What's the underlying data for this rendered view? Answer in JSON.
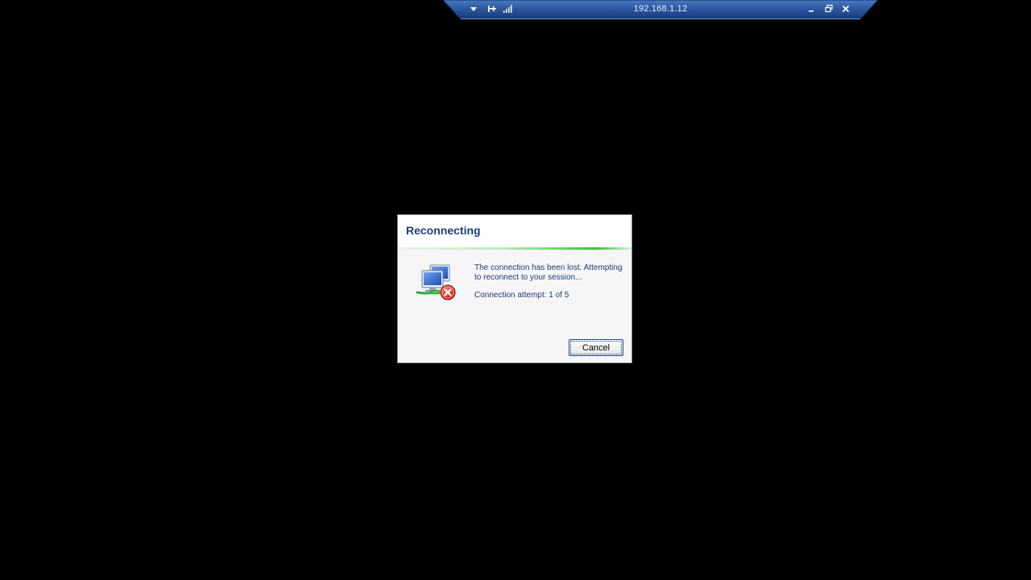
{
  "connection_bar": {
    "host": "192.168.1.12",
    "icons": {
      "menu": "chevron-down-icon",
      "pin": "pin-icon",
      "signal": "signal-bars-icon",
      "minimize": "minimize-icon",
      "restore": "restore-icon",
      "close": "close-icon"
    },
    "colors": {
      "bar_top": "#3f6db5",
      "bar_bottom": "#1a3f82"
    }
  },
  "dialog": {
    "title": "Reconnecting",
    "message": "The connection has been lost. Attempting to reconnect to your session...",
    "attempt_text": "Connection attempt: 1 of 5",
    "cancel_label": "Cancel",
    "icon": "network-computer-error-icon",
    "colors": {
      "title": "#1f3f7a",
      "text": "#1d3a72",
      "accent": "#3ac43a"
    }
  }
}
